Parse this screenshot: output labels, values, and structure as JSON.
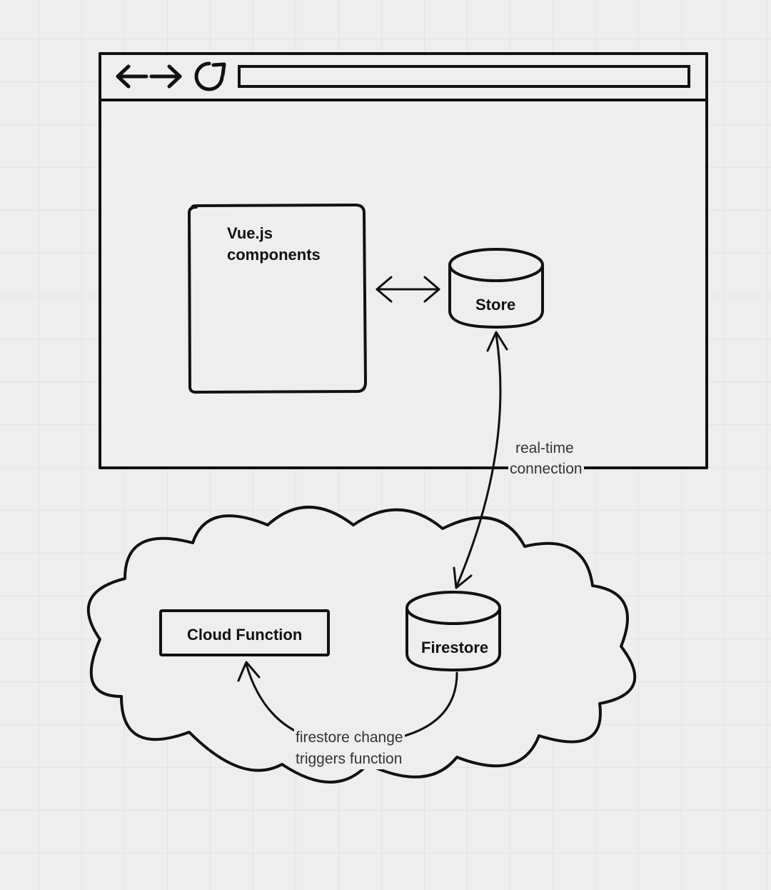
{
  "nodes": {
    "vue": {
      "label1": "Vue.js",
      "label2": "components"
    },
    "store": {
      "label": "Store"
    },
    "cloud_function": {
      "label": "Cloud Function"
    },
    "firestore": {
      "label": "Firestore"
    }
  },
  "connections": {
    "realtime": {
      "label1": "real-time",
      "label2": "connection"
    },
    "trigger": {
      "label1": "firestore change",
      "label2": "triggers function"
    }
  }
}
